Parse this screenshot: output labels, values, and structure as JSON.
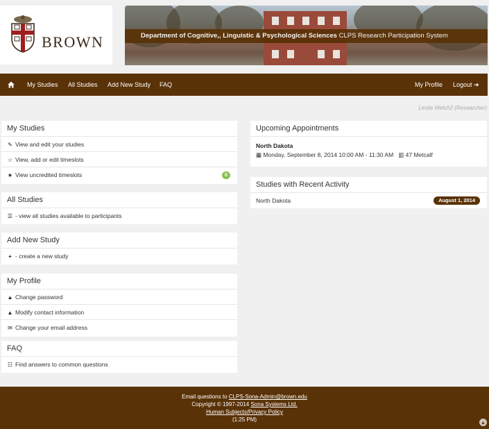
{
  "brand": {
    "name": "BROWN"
  },
  "banner": {
    "title_bold": "Department of Cognitive,, Linguistic & Psychological Sciences",
    "title_light": "CLPS Research Participation System"
  },
  "nav": {
    "left": [
      {
        "label": "My Studies"
      },
      {
        "label": "All Studies"
      },
      {
        "label": "Add New Study"
      },
      {
        "label": "FAQ"
      }
    ],
    "right": [
      {
        "label": "My Profile"
      },
      {
        "label": "Logout"
      }
    ]
  },
  "user": {
    "line": "Leslie Welch2 (Researcher)"
  },
  "my_studies": {
    "title": "My Studies",
    "items": [
      {
        "label": "View and edit your studies",
        "icon": "edit-icon"
      },
      {
        "label": "View, add or edit timeslots",
        "icon": "star-half-icon"
      },
      {
        "label": "View uncredited timeslots",
        "icon": "star-icon",
        "count": "0"
      }
    ]
  },
  "all_studies": {
    "title": "All Studies",
    "items": [
      {
        "label": "- view all studies available to participants",
        "icon": "list-icon"
      }
    ]
  },
  "add_study": {
    "title": "Add New Study",
    "items": [
      {
        "label": "- create a new study",
        "icon": "plus-icon"
      }
    ]
  },
  "my_profile": {
    "title": "My Profile",
    "items": [
      {
        "label": "Change password",
        "icon": "lock-icon"
      },
      {
        "label": "Modify contact information",
        "icon": "user-icon"
      },
      {
        "label": "Change your email address",
        "icon": "envelope-icon"
      }
    ]
  },
  "faq": {
    "title": "FAQ",
    "items": [
      {
        "label": "Find answers to common questions",
        "icon": "comments-icon"
      }
    ]
  },
  "appointments": {
    "title": "Upcoming Appointments",
    "study": "North Dakota",
    "datetime": "Monday, September 8, 2014 10:00 AM - 11:30 AM",
    "location": "47 Metcalf"
  },
  "recent": {
    "title": "Studies with Recent Activity",
    "items": [
      {
        "study": "North Dakota",
        "date": "August 1, 2014"
      }
    ]
  },
  "footer": {
    "email_prefix": "Email questions to ",
    "email": "CLPS-Sona-Admin@brown.edu",
    "copyright_prefix": "Copyright © 1997-2014 ",
    "company": "Sona Systems Ltd.",
    "privacy": "Human Subjects/Privacy Policy",
    "time": "(1:25 PM)"
  },
  "colors": {
    "brand_brown": "#5a3208",
    "badge_green": "#8cc152"
  }
}
